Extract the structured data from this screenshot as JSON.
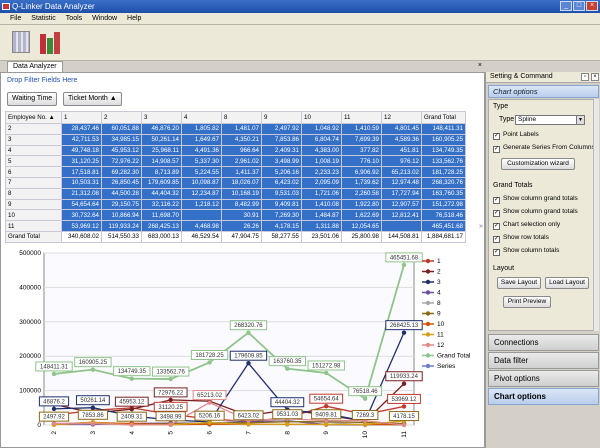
{
  "app": {
    "title": "Q-Linker Data Analyzer"
  },
  "menu": [
    "File",
    "Statistic",
    "Tools",
    "Window",
    "Help"
  ],
  "tab": {
    "label": "Data Analyzer",
    "close": "×"
  },
  "drop_hint": "Drop Filter Fields Here",
  "filters": {
    "waiting": "Waiting Time",
    "ticket": "Ticket Month ▲"
  },
  "table": {
    "corner": "Employee No. ▲",
    "cols": [
      "1",
      "2",
      "3",
      "4",
      "8",
      "9",
      "10",
      "11",
      "12",
      "Grand Total"
    ],
    "rows": [
      {
        "h": "2",
        "v": [
          "28,437.46",
          "60,051.88",
          "46,876.20",
          "1,805.82",
          "1,481.07",
          "2,497.92",
          "1,048.92",
          "1,410.59",
          "4,801.45",
          "148,411.31"
        ]
      },
      {
        "h": "3",
        "v": [
          "42,711.53",
          "34,985.15",
          "50,261.14",
          "1,649.67",
          "4,350.21",
          "7,853.86",
          "6,804.74",
          "7,699.39",
          "4,589.36",
          "160,905.25"
        ]
      },
      {
        "h": "4",
        "v": [
          "49,748.18",
          "45,953.12",
          "25,968.11",
          "4,491.36",
          "966.64",
          "2,409.31",
          "4,383.00",
          "377.82",
          "451.81",
          "134,749.35"
        ]
      },
      {
        "h": "5",
        "v": [
          "31,120.25",
          "72,976.22",
          "14,908.57",
          "5,337.30",
          "2,961.02",
          "3,498.99",
          "1,008.19",
          "776.10",
          "976.12",
          "133,562.76"
        ]
      },
      {
        "h": "6",
        "v": [
          "17,518.81",
          "69,282.30",
          "8,713.89",
          "5,224.55",
          "1,411.37",
          "5,206.16",
          "2,233.23",
          "6,906.92",
          "65,213.02",
          "181,728.25"
        ]
      },
      {
        "h": "7",
        "v": [
          "10,503.31",
          "26,850.45",
          "179,609.85",
          "10,098.87",
          "18,026.07",
          "6,423.02",
          "2,095.09",
          "1,739.62",
          "12,974.48",
          "268,320.76"
        ]
      },
      {
        "h": "8",
        "v": [
          "21,312.08",
          "44,500.28",
          "44,404.32",
          "12,234.87",
          "10,168.19",
          "9,531.03",
          "1,721.06",
          "2,260.58",
          "17,727.94",
          "163,760.35"
        ]
      },
      {
        "h": "9",
        "v": [
          "54,654.64",
          "29,150.75",
          "32,116.22",
          "1,218.12",
          "8,482.99",
          "9,409.81",
          "1,410.08",
          "1,922.80",
          "12,907.57",
          "151,272.98"
        ]
      },
      {
        "h": "10",
        "v": [
          "30,732.64",
          "10,866.94",
          "11,698.70",
          "",
          "30.91",
          "7,269.30",
          "1,484.87",
          "1,622.69",
          "12,812.41",
          "76,518.46"
        ]
      },
      {
        "h": "11",
        "v": [
          "53,969.12",
          "119,933.24",
          "268,425.13",
          "4,468.98",
          "26.26",
          "4,178.15",
          "1,311.88",
          "12,054.65",
          "",
          "465,451.68"
        ]
      }
    ],
    "grand": {
      "h": "Grand Total",
      "v": [
        "340,608.02",
        "514,550.33",
        "683,000.13",
        "46,529.54",
        "47,904.75",
        "58,277.55",
        "23,501.06",
        "25,800.98",
        "144,508.81",
        "1,884,681.17"
      ]
    }
  },
  "chart_data": {
    "type": "line",
    "categories": [
      "2",
      "3",
      "4",
      "5",
      "6",
      "7",
      "8",
      "9",
      "10",
      "11"
    ],
    "yticks": [
      "0",
      "100000",
      "200000",
      "300000",
      "400000",
      "500000"
    ],
    "ylim": [
      0,
      500000
    ],
    "series": [
      {
        "name": "1",
        "color": "#c0392b",
        "values": [
          28437.46,
          42711.53,
          49748.18,
          31120.25,
          17518.81,
          10503.31,
          21312.08,
          54654.64,
          30732.64,
          53969.12
        ]
      },
      {
        "name": "2",
        "color": "#7a1f1f",
        "values": [
          60051.88,
          34985.15,
          45953.12,
          72976.22,
          69282.3,
          26850.45,
          44500.28,
          29150.75,
          10866.94,
          119933.24
        ]
      },
      {
        "name": "3",
        "color": "#1f2f6a",
        "values": [
          46876.2,
          50261.14,
          25968.11,
          14908.57,
          8713.89,
          179609.85,
          44404.32,
          32116.22,
          11698.7,
          268425.13
        ]
      },
      {
        "name": "4",
        "color": "#6d4c9c",
        "values": [
          1805.82,
          1649.67,
          4491.36,
          5337.3,
          5224.55,
          10098.87,
          12234.87,
          1218.12,
          0,
          4468.98
        ]
      },
      {
        "name": "8",
        "color": "#a9a9a9",
        "values": [
          1481.07,
          4350.21,
          966.64,
          2961.02,
          1411.37,
          18026.07,
          10168.19,
          8482.99,
          30.91,
          26.26
        ]
      },
      {
        "name": "9",
        "color": "#8b6914",
        "values": [
          2497.92,
          7853.86,
          2409.31,
          3498.99,
          5206.16,
          6423.02,
          9531.03,
          9409.81,
          7269.3,
          4178.15
        ]
      },
      {
        "name": "10",
        "color": "#d35400",
        "values": [
          1048.92,
          6804.74,
          4383.0,
          1008.19,
          2233.23,
          2095.09,
          1721.06,
          1410.08,
          1484.87,
          1311.88
        ]
      },
      {
        "name": "11",
        "color": "#d4a017",
        "values": [
          1410.59,
          7699.39,
          377.82,
          776.1,
          6906.92,
          1739.62,
          2260.58,
          1922.8,
          1622.69,
          12054.65
        ]
      },
      {
        "name": "12",
        "color": "#e08a8a",
        "values": [
          4801.45,
          4589.36,
          451.81,
          976.12,
          65213.02,
          12974.48,
          17727.94,
          12907.57,
          12812.41,
          0
        ]
      },
      {
        "name": "Grand Total",
        "color": "#8fc48a",
        "values": [
          148411.31,
          160905.25,
          134749.35,
          133562.76,
          181728.25,
          268320.76,
          163760.35,
          151272.98,
          76518.46,
          465451.68
        ]
      },
      {
        "name": "Series",
        "color": "#6a7fc8",
        "values": []
      }
    ],
    "labels": [
      {
        "s": 9,
        "i": 0,
        "t": "148411.31"
      },
      {
        "s": 9,
        "i": 1,
        "t": "160905.25"
      },
      {
        "s": 9,
        "i": 2,
        "t": "134749.35"
      },
      {
        "s": 9,
        "i": 3,
        "t": "133562.76"
      },
      {
        "s": 9,
        "i": 4,
        "t": "181728.25"
      },
      {
        "s": 9,
        "i": 5,
        "t": "268320.76"
      },
      {
        "s": 9,
        "i": 6,
        "t": "163760.35"
      },
      {
        "s": 9,
        "i": 7,
        "t": "151272.98"
      },
      {
        "s": 9,
        "i": 8,
        "t": "76518.46"
      },
      {
        "s": 9,
        "i": 9,
        "t": "465451.68"
      },
      {
        "s": 2,
        "i": 5,
        "t": "179609.85"
      },
      {
        "s": 2,
        "i": 9,
        "t": "268425.13"
      },
      {
        "s": 1,
        "i": 9,
        "t": "119933.24"
      },
      {
        "s": 1,
        "i": 3,
        "t": "72976.22"
      },
      {
        "s": 2,
        "i": 0,
        "t": "46876.2"
      },
      {
        "s": 2,
        "i": 1,
        "t": "50261.14"
      },
      {
        "s": 1,
        "i": 2,
        "t": "45953.12"
      },
      {
        "s": 0,
        "i": 3,
        "t": "31120.25"
      },
      {
        "s": 8,
        "i": 4,
        "t": "65213.02"
      },
      {
        "s": 2,
        "i": 6,
        "t": "44404.32"
      },
      {
        "s": 0,
        "i": 7,
        "t": "54654.64"
      },
      {
        "s": 0,
        "i": 9,
        "t": "53969.12"
      },
      {
        "s": 9,
        "i": 9,
        "t": ""
      },
      {
        "s": 5,
        "i": 0,
        "t": "2497.92"
      },
      {
        "s": 5,
        "i": 1,
        "t": "7853.86"
      },
      {
        "s": 5,
        "i": 2,
        "t": "2409.31"
      },
      {
        "s": 5,
        "i": 3,
        "t": "3498.99"
      },
      {
        "s": 5,
        "i": 4,
        "t": "5206.16"
      },
      {
        "s": 5,
        "i": 5,
        "t": "6423.02"
      },
      {
        "s": 5,
        "i": 6,
        "t": "9531.03"
      },
      {
        "s": 5,
        "i": 7,
        "t": "9409.81"
      },
      {
        "s": 5,
        "i": 8,
        "t": "7269.3"
      },
      {
        "s": 5,
        "i": 9,
        "t": "4178.15"
      }
    ]
  },
  "side": {
    "title": "Setting & Command",
    "header": "Chart options",
    "type_group": "Type",
    "type_label": "Type",
    "type_value": "Spline",
    "point_labels": "Point Labels",
    "gen_series": "Generate Series From Columns",
    "custom_wizard": "Customization wizard",
    "grand_group": "Grand Totals",
    "g1": "Show column grand totals",
    "g2": "Show column grand totals",
    "g3": "Chart selection only",
    "g4": "Show row totals",
    "g5": "Show column totals",
    "layout_group": "Layout",
    "save_layout": "Save Layout",
    "load_layout": "Load Layout",
    "print_preview": "Print Preview",
    "nav": [
      "Connections",
      "Data filter",
      "Pivot options",
      "Chart options"
    ]
  }
}
